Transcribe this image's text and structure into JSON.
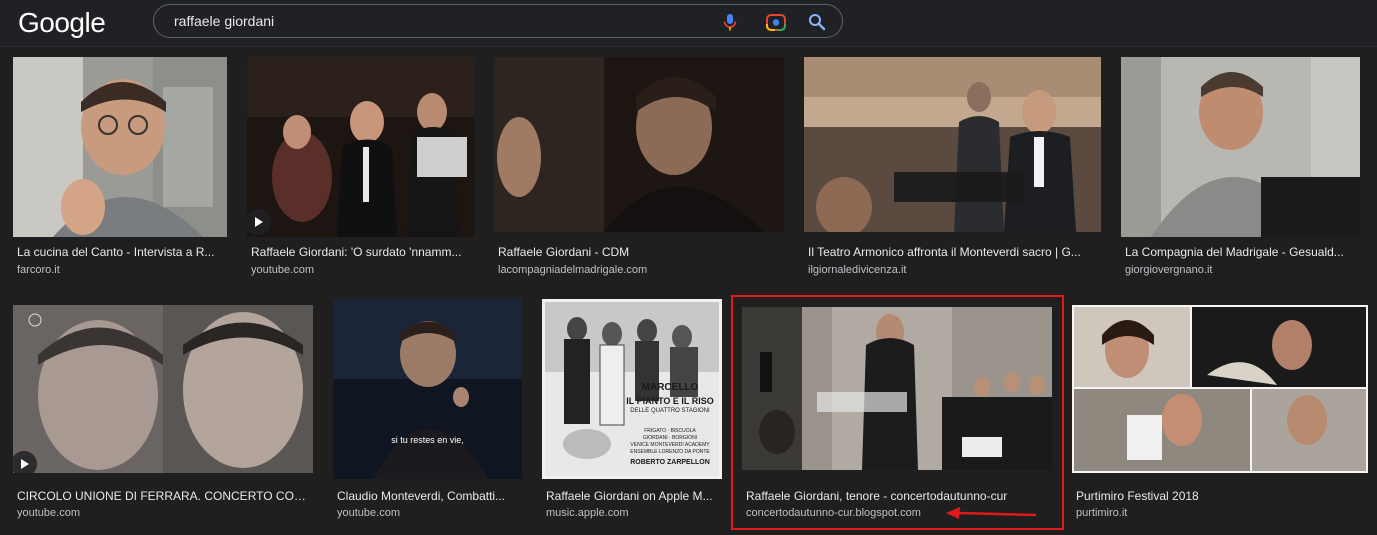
{
  "header": {
    "logo": "Google",
    "search": {
      "query": "raffaele giordani",
      "icons": [
        "mic-icon",
        "camera-lens-icon",
        "search-icon"
      ]
    }
  },
  "colors": {
    "background": "#202124",
    "title_text": "#e8eaed",
    "source_text": "#bdc1c6",
    "highlight": "#e0191b",
    "mic_blue": "#4285f4",
    "mic_red": "#ea4335",
    "lens_yellow": "#fbbc04",
    "lens_green": "#34a853",
    "search_blue": "#8ab4f8"
  },
  "results": [
    {
      "title": "La cucina del Canto - Intervista a R...",
      "source": "farcoro.it",
      "video": false
    },
    {
      "title": "Raffaele Giordani: 'O surdato 'nnamm...",
      "source": "youtube.com",
      "video": true
    },
    {
      "title": "Raffaele Giordani - CDM",
      "source": "lacompagniadelmadrigale.com",
      "video": false
    },
    {
      "title": "Il Teatro Armonico affronta il Monteverdi sacro | G...",
      "source": "ilgiornaledivicenza.it",
      "video": false
    },
    {
      "title": "La Compagnia del Madrigale - Gesuald...",
      "source": "giorgiovergnano.it",
      "video": false
    },
    {
      "title": "CIRCOLO UNIONE DI FERRARA. CONCERTO CON R...",
      "source": "youtube.com",
      "video": true
    },
    {
      "title": "Claudio Monteverdi, Combatti...",
      "source": "youtube.com",
      "video": false,
      "subtitle": "si tu restes en vie,"
    },
    {
      "title": "Raffaele Giordani on Apple M...",
      "source": "music.apple.com",
      "video": false,
      "poster": {
        "line1": "MARCELLO",
        "line2": "IL PIANTO E IL RISO",
        "line3": "DELLE QUATTRO STAGIONI",
        "credits1": "FRIGATO · BISCUOLA",
        "credits2": "GIORDANI · BORGIONI",
        "credits3": "VENICE MONTEVERDI ACADEMY",
        "credits4": "ENSEMBLE LORENZO DA PONTE",
        "conductor": "ROBERTO ZARPELLON"
      }
    },
    {
      "title": "Raffaele Giordani, tenore - concertodautunno-cur",
      "source": "concertodautunno-cur.blogspot.com",
      "video": false,
      "highlighted": true
    },
    {
      "title": "Purtimiro Festival 2018",
      "source": "purtimiro.it",
      "video": false
    }
  ]
}
